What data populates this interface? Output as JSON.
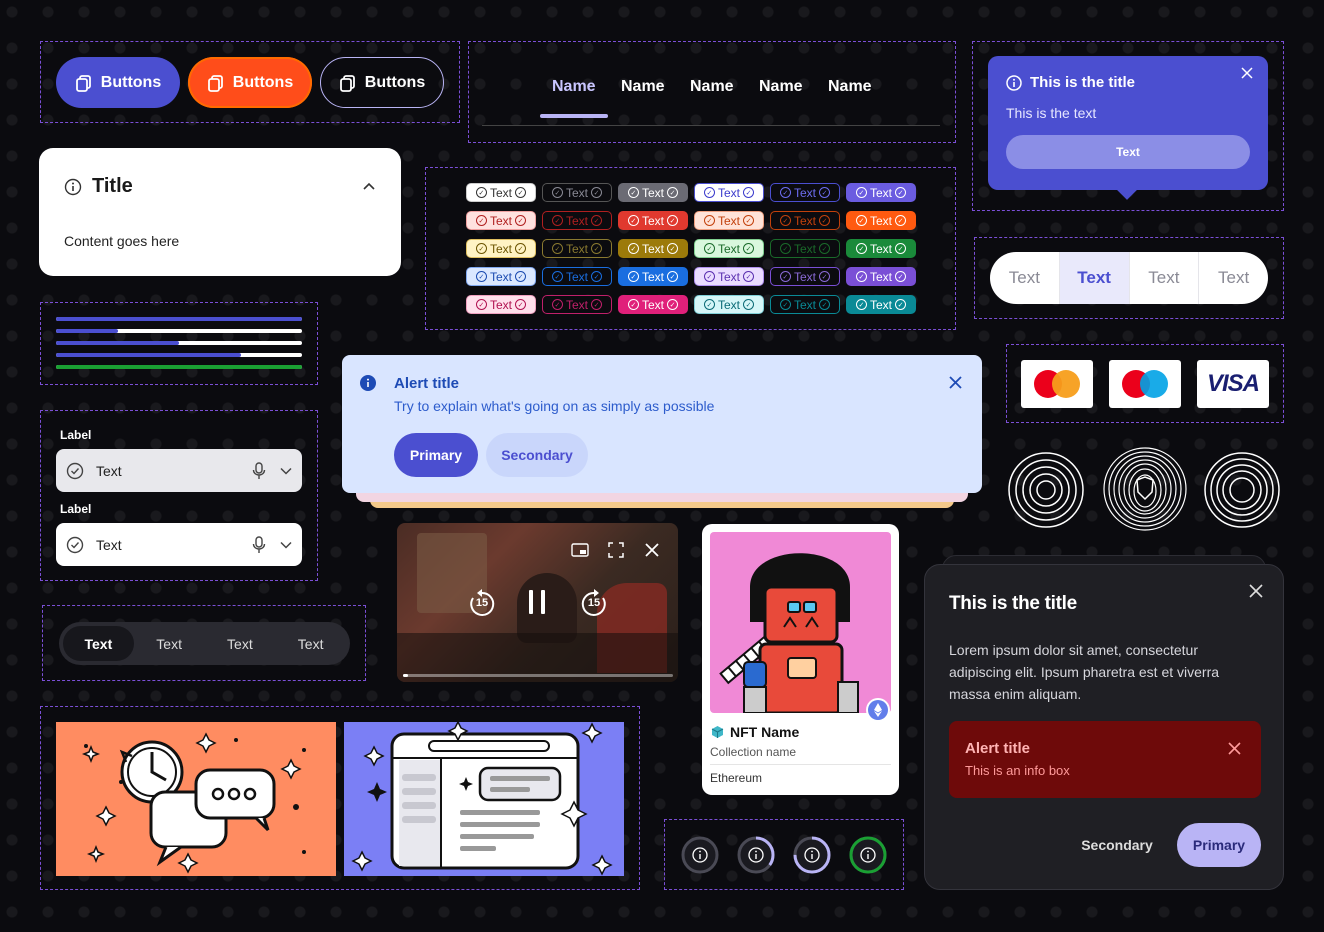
{
  "buttons": [
    {
      "label": "Buttons",
      "style": "filled-indigo",
      "icon": "copy-icon"
    },
    {
      "label": "Buttons",
      "style": "filled-orange",
      "icon": "copy-icon"
    },
    {
      "label": "Buttons",
      "style": "outline",
      "icon": "copy-icon"
    }
  ],
  "tabs": {
    "items": [
      "Name",
      "Name",
      "Name",
      "Name",
      "Name"
    ],
    "active_index": 0
  },
  "tooltip": {
    "title": "This is the title",
    "text": "This is the text",
    "button": "Text"
  },
  "accordion": {
    "title": "Title",
    "content": "Content goes here"
  },
  "chips": {
    "label": "Text",
    "rows": 5,
    "cols": 6
  },
  "segmented_light": {
    "items": [
      "Text",
      "Text",
      "Text",
      "Text"
    ],
    "active_index": 1
  },
  "progress": [
    {
      "value": 1.0,
      "color": "#4b4fd0",
      "track": "#ffffff"
    },
    {
      "value": 0.25,
      "color": "#4b4fd0",
      "track": "#ffffff"
    },
    {
      "value": 0.5,
      "color": "#4b4fd0",
      "track": "#ffffff"
    },
    {
      "value": 0.75,
      "color": "#4b4fd0",
      "track": "#ffffff"
    },
    {
      "value": 1.0,
      "color": "#1aa033",
      "track": "#ffffff"
    }
  ],
  "alert": {
    "title": "Alert title",
    "message": "Try to explain what's going on as simply as possible",
    "primary": "Primary",
    "secondary": "Secondary"
  },
  "payments": [
    "mastercard-logo",
    "maestro-logo",
    "visa-logo"
  ],
  "payment_text": {
    "visa": "VISA"
  },
  "inputs": [
    {
      "label": "Label",
      "value": "Text",
      "style": "filled"
    },
    {
      "label": "Label",
      "value": "Text",
      "style": "outlined"
    }
  ],
  "segmented_dark": {
    "items": [
      "Text",
      "Text",
      "Text",
      "Text"
    ],
    "active_index": 0
  },
  "video": {
    "skip_back": "15",
    "skip_forward": "15",
    "progress": 0.02
  },
  "nft": {
    "name": "NFT Name",
    "collection": "Collection name",
    "chain": "Ethereum"
  },
  "modal": {
    "title": "This is the title",
    "body": "Lorem ipsum dolor sit amet, consectetur adipiscing elit. Ipsum pharetra est et viverra massa enim aliquam.",
    "alert_title": "Alert title",
    "alert_text": "This is an info box",
    "secondary": "Secondary",
    "primary": "Primary"
  },
  "loaders": [
    {
      "progress": 0.0,
      "color": "#9a9aa6"
    },
    {
      "progress": 0.35,
      "color": "#b9b4f5"
    },
    {
      "progress": 0.75,
      "color": "#b9b4f5"
    },
    {
      "progress": 1.0,
      "color": "#1aa033"
    }
  ],
  "colors": {
    "indigo": "#4b4fd0",
    "orange": "#ff4d1a",
    "lavender": "#b9b4f5",
    "dash": "#7b4fd6"
  }
}
